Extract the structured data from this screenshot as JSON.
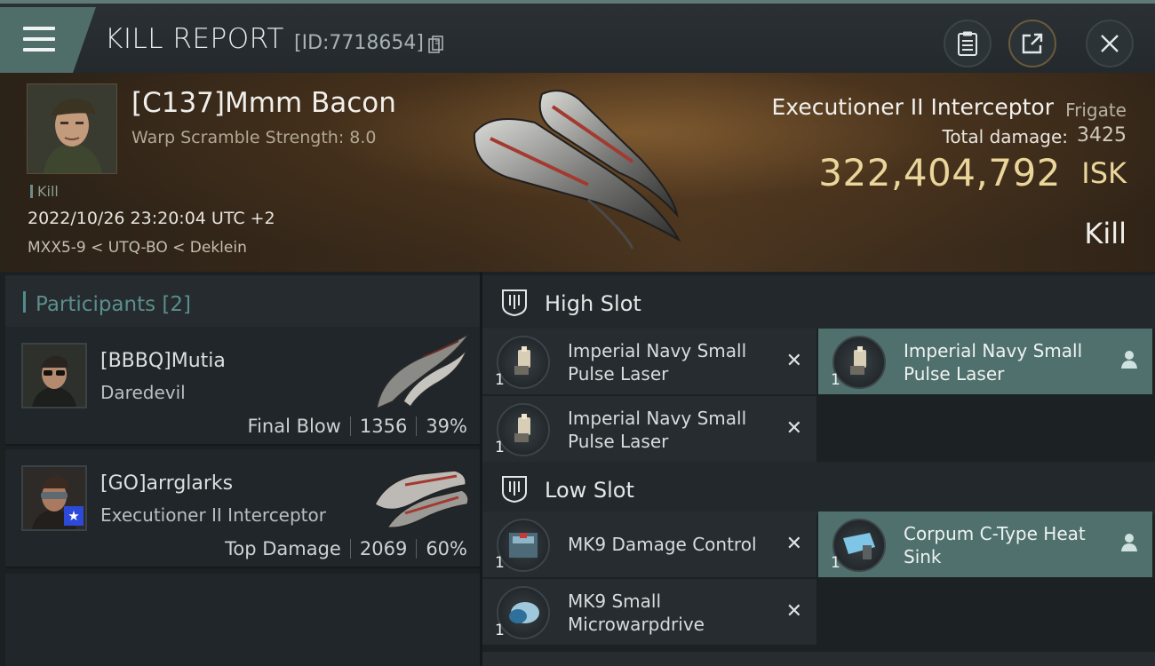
{
  "header": {
    "title": "KILL REPORT",
    "report_id": "[ID:7718654]",
    "icons": [
      "menu-icon",
      "copy-icon",
      "clipboard-icon",
      "share-icon",
      "close-icon"
    ]
  },
  "victim": {
    "name": "[C137]Mmm Bacon",
    "warp_scramble": "Warp Scramble Strength: 8.0",
    "kill_tag": "Kill",
    "time": "2022/10/26 23:20:04 UTC +2",
    "route": "MXX5-9 < UTQ-BO < Deklein",
    "ship_name": "Executioner II Interceptor",
    "ship_class": "Frigate",
    "total_damage_label": "Total damage:",
    "total_damage_value": "3425",
    "isk_value": "322,404,792",
    "isk_unit": "ISK",
    "result": "Kill"
  },
  "participants": {
    "header": "Participants",
    "count": "[2]",
    "items": [
      {
        "name": "[BBBQ]Mutia",
        "ship": "Daredevil",
        "role": "Final Blow",
        "damage": "1356",
        "percent": "39%"
      },
      {
        "name": "[GO]arrglarks",
        "ship": "Executioner II Interceptor",
        "role": "Top Damage",
        "damage": "2069",
        "percent": "60%",
        "badge": "★"
      }
    ]
  },
  "slots": {
    "high": {
      "label": "High Slot",
      "modules": [
        {
          "name": "Imperial Navy Small Pulse Laser",
          "qty": "1",
          "state": "destroyed"
        },
        {
          "name": "Imperial Navy Small Pulse Laser",
          "qty": "1",
          "state": "dropped"
        },
        {
          "name": "Imperial Navy Small Pulse Laser",
          "qty": "1",
          "state": "destroyed"
        }
      ]
    },
    "low": {
      "label": "Low Slot",
      "modules": [
        {
          "name": "MK9 Damage Control",
          "qty": "1",
          "state": "destroyed"
        },
        {
          "name": "Corpum C-Type Heat Sink",
          "qty": "1",
          "state": "dropped"
        },
        {
          "name": "MK9 Small Microwarpdrive",
          "qty": "1",
          "state": "destroyed"
        }
      ]
    },
    "destroyed_mark": "✕"
  },
  "colors": {
    "accent_teal": "#4f706c",
    "isk_gold": "#ead59a",
    "panel_dark": "#1b2023"
  }
}
